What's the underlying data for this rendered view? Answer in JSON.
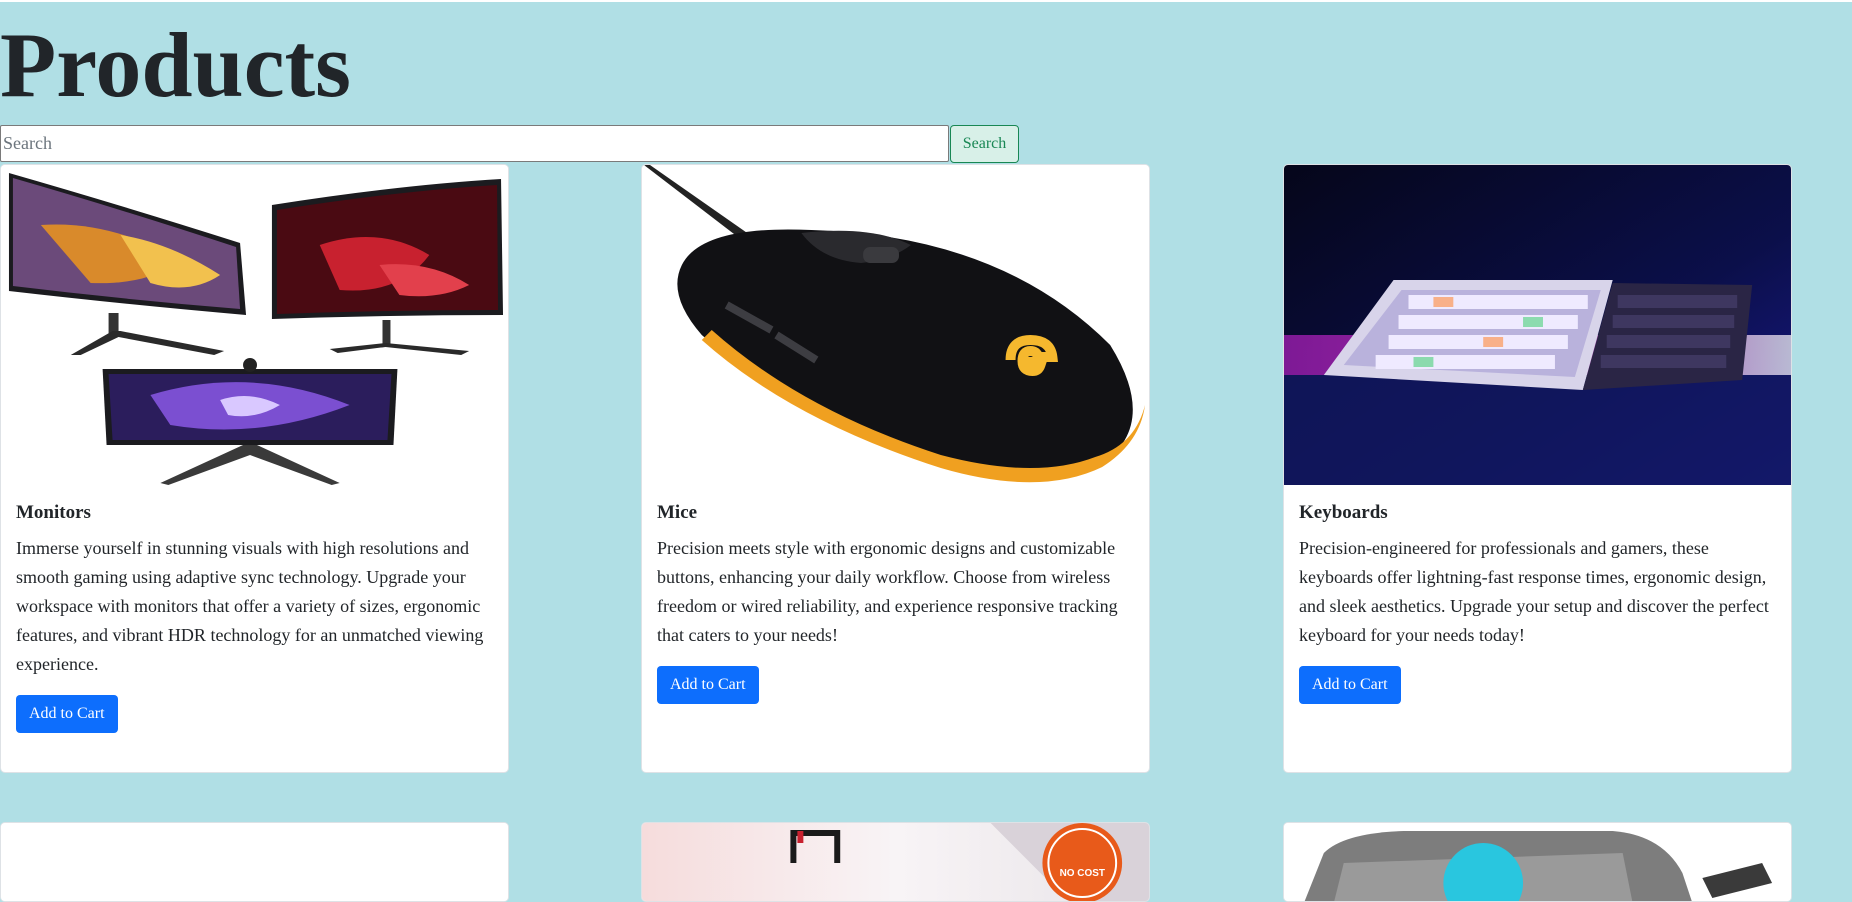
{
  "page": {
    "title": "Products"
  },
  "search": {
    "placeholder": "Search",
    "value": "",
    "button_label": "Search"
  },
  "products": [
    {
      "name": "Monitors",
      "description": "Immerse yourself in stunning visuals with high resolutions and smooth gaming using adaptive sync technology. Upgrade your workspace with monitors that offer a variety of sizes, ergonomic features, and vibrant HDR technology for an unmatched viewing experience.",
      "button_label": "Add to Cart",
      "image": "monitors-image"
    },
    {
      "name": "Mice",
      "description": "Precision meets style with ergonomic designs and customizable buttons, enhancing your daily workflow. Choose from wireless freedom or wired reliability, and experience responsive tracking that caters to your needs!",
      "button_label": "Add to Cart",
      "image": "mouse-image"
    },
    {
      "name": "Keyboards",
      "description": "Precision-engineered for professionals and gamers, these keyboards offer lightning-fast response times, ergonomic design, and sleek aesthetics. Upgrade your setup and discover the perfect keyboard for your needs today!",
      "button_label": "Add to Cart",
      "image": "keyboards-image"
    }
  ],
  "partial_cards": [
    {
      "image": "blank-image"
    },
    {
      "image": "luggage-promo-image",
      "badge_text": "NO COST"
    },
    {
      "image": "gray-device-image"
    }
  ],
  "colors": {
    "page_background": "#b0dfe5",
    "primary_button": "#0d6efd",
    "search_button_border": "#198754",
    "heading_text": "#212529"
  }
}
